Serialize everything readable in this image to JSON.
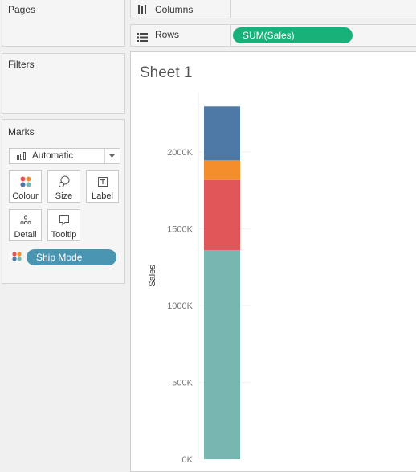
{
  "cards": {
    "pages": "Pages",
    "filters": "Filters",
    "marks": "Marks"
  },
  "marks": {
    "mark_type": "Automatic",
    "buttons": {
      "colour": "Colour",
      "size": "Size",
      "label": "Label",
      "detail": "Detail",
      "tooltip": "Tooltip"
    },
    "colour_field": "Ship Mode"
  },
  "shelves": {
    "columns": "Columns",
    "rows": "Rows",
    "rows_pill": "SUM(Sales)"
  },
  "sheet": {
    "title": "Sheet 1"
  },
  "colors": {
    "rows_pill": "#19b17a",
    "dimension_pill": "#4a96b2"
  },
  "chart_data": {
    "type": "bar",
    "stacked": true,
    "ylabel": "Sales",
    "ylim": [
      0,
      2350000
    ],
    "yticks": [
      0,
      500000,
      1000000,
      1500000,
      2000000
    ],
    "ytick_labels": [
      "0K",
      "500K",
      "1000K",
      "1500K",
      "2000K"
    ],
    "grid": true,
    "series": [
      {
        "values": [
          1360000
        ],
        "color": "#76b7b2"
      },
      {
        "values": [
          458000
        ],
        "color": "#e15759"
      },
      {
        "values": [
          128000
        ],
        "color": "#f28e2b"
      },
      {
        "values": [
          351000
        ],
        "color": "#4e79a7"
      }
    ]
  }
}
